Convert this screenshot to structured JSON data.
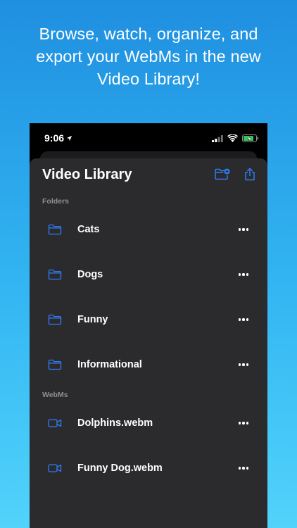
{
  "headline": {
    "line1": "Browse, watch, organize, and",
    "line2": "export your WebMs in the new",
    "line3": "Video Library!"
  },
  "status_bar": {
    "time": "9:06",
    "icons": [
      "location-arrow-icon",
      "cellular-signal-icon",
      "wifi-icon",
      "battery-charging-icon"
    ]
  },
  "library": {
    "title": "Video Library",
    "header_actions": [
      "new-folder-icon",
      "share-icon"
    ],
    "accent_color": "#2f7cf6",
    "sections": {
      "folders_label": "Folders",
      "webms_label": "WebMs"
    },
    "folders": [
      {
        "name": "Cats"
      },
      {
        "name": "Dogs"
      },
      {
        "name": "Funny"
      },
      {
        "name": "Informational"
      }
    ],
    "webms": [
      {
        "name": "Dolphins.webm"
      },
      {
        "name": "Funny Dog.webm"
      }
    ]
  }
}
